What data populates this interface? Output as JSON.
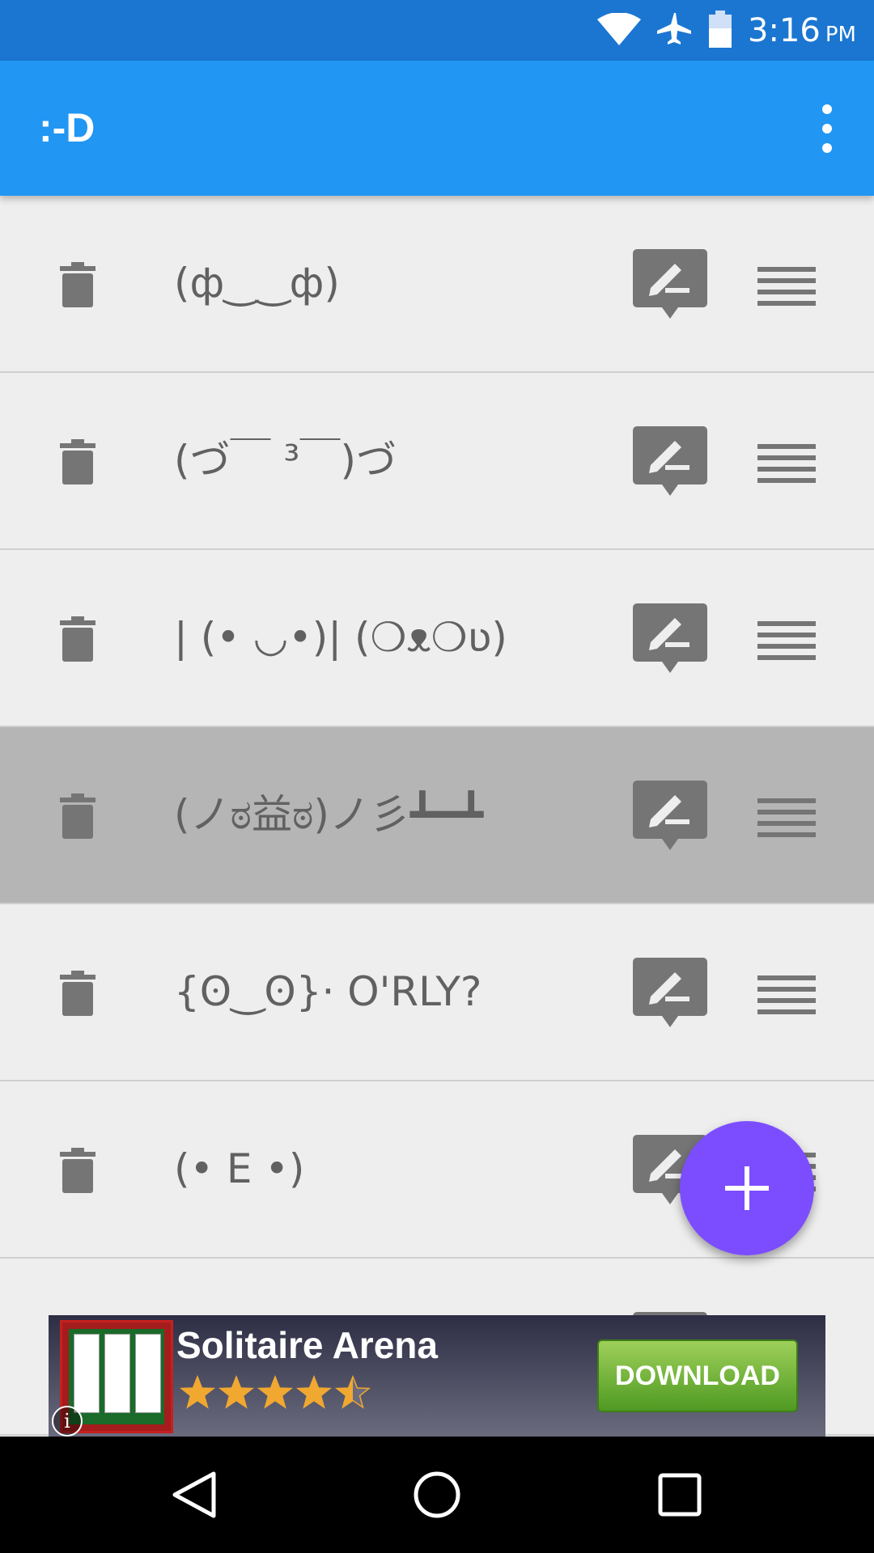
{
  "status_bar": {
    "time": "3:16",
    "ampm": "PM",
    "icons": [
      "wifi-icon",
      "airplane-icon",
      "battery-icon"
    ]
  },
  "app_bar": {
    "title": ":-D",
    "menu_icon": "more-vert-icon"
  },
  "emoticons": [
    {
      "text": "(ф‿‿ф)",
      "selected": false
    },
    {
      "text": "(づ￣ ³￣)づ",
      "selected": false
    },
    {
      "text": "| (• ◡•)| (❍ᴥ❍ʋ)",
      "selected": false
    },
    {
      "text": "(ノಠ益ಠ)ノ彡┻━┻",
      "selected": true
    },
    {
      "text": "{ʘ‿ʘ}· O'RLY?",
      "selected": false
    },
    {
      "text": "(• E •)",
      "selected": false
    },
    {
      "text": "",
      "selected": false
    }
  ],
  "fab": {
    "icon": "plus-icon"
  },
  "ad": {
    "title": "Solitaire Arena",
    "rating": 4.5,
    "download_label": "DOWNLOAD",
    "info_label": "i"
  },
  "navigation": {
    "buttons": [
      "back-icon",
      "home-icon",
      "recents-icon"
    ]
  },
  "colors": {
    "status_bar": "#1b76d2",
    "app_bar": "#2196f3",
    "fab": "#7c4dff",
    "selected_row": "#b5b5b5",
    "icon_gray": "#757575"
  }
}
